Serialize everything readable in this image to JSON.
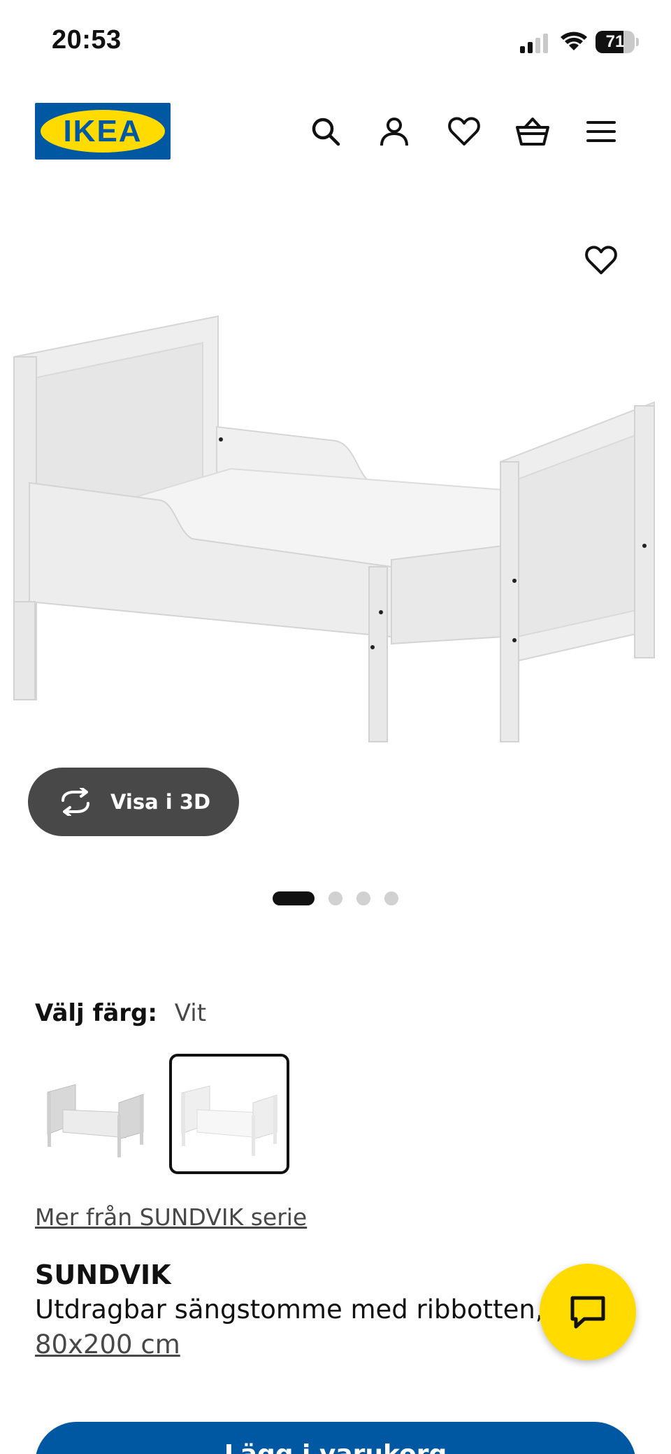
{
  "status_bar": {
    "time": "20:53",
    "battery_level": "71",
    "battery_fraction": 0.71,
    "signal_icon": "cellular-signal-icon",
    "wifi_icon": "wifi-icon"
  },
  "header": {
    "logo_text": "IKEA",
    "icons": [
      "search-icon",
      "account-icon",
      "heart-icon",
      "basket-icon",
      "menu-icon"
    ],
    "brand_blue": "#0058a3",
    "brand_yellow": "#ffdb00"
  },
  "gallery": {
    "view_3d_label": "Visa i 3D",
    "slide_count": 4,
    "active_slide": 1,
    "favorite_icon": "heart-icon"
  },
  "color_picker": {
    "label": "Välj färg:",
    "selected_value": "Vit",
    "options": [
      "grey-bed-thumbnail",
      "white-bed-thumbnail"
    ],
    "selected_index": 1
  },
  "product": {
    "series_link": "Mer från SUNDVIK serie",
    "name": "SUNDVIK",
    "description": "Utdragbar sängstomme med ribbotten,",
    "size": "80x200 cm"
  },
  "cta": {
    "label": "Lägg i varukorg"
  },
  "chat": {
    "icon": "chat-icon",
    "color": "#ffdb00"
  }
}
